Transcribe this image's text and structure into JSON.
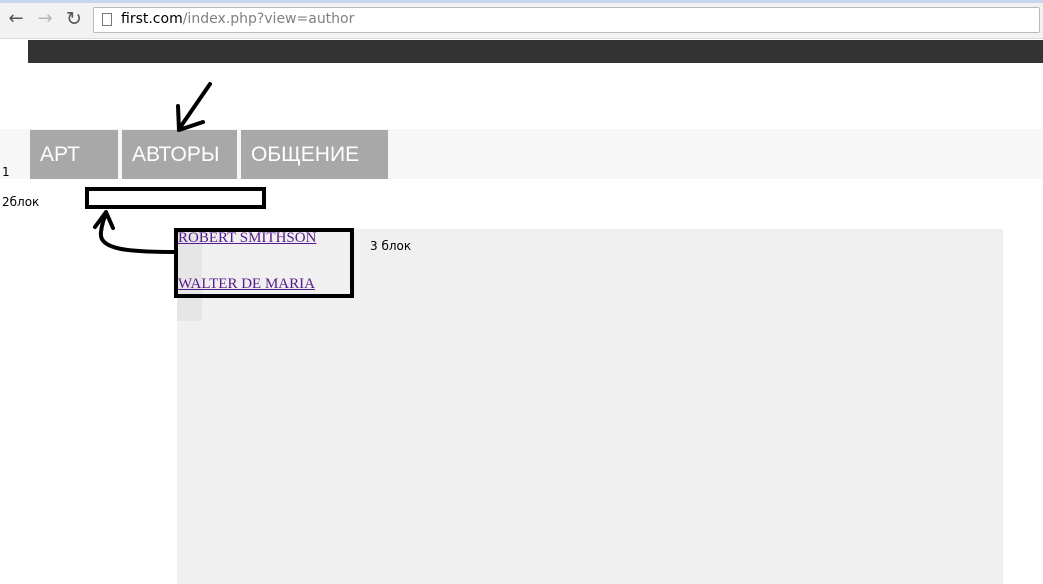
{
  "browser": {
    "url_host": "first.com",
    "url_path": "/index.php?view=author",
    "back_icon": "arrow-left-icon",
    "forward_icon": "arrow-right-icon",
    "reload_icon": "reload-icon"
  },
  "menu": {
    "items": [
      {
        "label": "АРТ"
      },
      {
        "label": "АВТОРЫ"
      },
      {
        "label": "ОБЩЕНИЕ"
      }
    ]
  },
  "labels": {
    "block1": "1",
    "block2": "2блок",
    "block3": "3 блок"
  },
  "authors": [
    {
      "name": "ROBERT SMITHSON"
    },
    {
      "name": "WALTER DE MARIA"
    }
  ],
  "colors": {
    "topbar": "#333333",
    "menu_item": "#a8a8a8",
    "content_bg": "#f0f0f0",
    "visited_link": "#551a8b"
  }
}
